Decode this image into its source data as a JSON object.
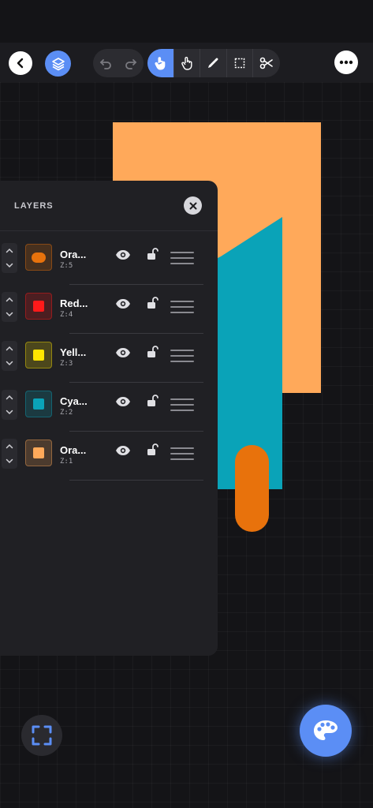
{
  "panel": {
    "title": "LAYERS",
    "layers": [
      {
        "name": "Ora...",
        "z": "Z:5",
        "color": "#e8720c",
        "shape": "pill"
      },
      {
        "name": "Red...",
        "z": "Z:4",
        "color": "#ff1a1a",
        "shape": "square"
      },
      {
        "name": "Yell...",
        "z": "Z:3",
        "color": "#ffe600",
        "shape": "square"
      },
      {
        "name": "Cya...",
        "z": "Z:2",
        "color": "#0aa3b8",
        "shape": "square"
      },
      {
        "name": "Ora...",
        "z": "Z:1",
        "color": "#ffa95a",
        "shape": "square"
      }
    ]
  },
  "canvas": {
    "shapes": [
      {
        "name": "orange-rectangle",
        "color": "#ffa95a"
      },
      {
        "name": "cyan-polygon",
        "color": "#0aa3b8"
      },
      {
        "name": "orange-pill",
        "color": "#e8720c"
      }
    ]
  },
  "colors": {
    "accent": "#5b8ef5",
    "background": "#141417",
    "panel": "#202024"
  },
  "toolbar": {
    "tools": [
      "hand-pointer-icon",
      "touch-icon",
      "eyedropper-icon",
      "selection-icon",
      "scissors-icon"
    ],
    "active_tool": "hand-pointer-icon"
  }
}
